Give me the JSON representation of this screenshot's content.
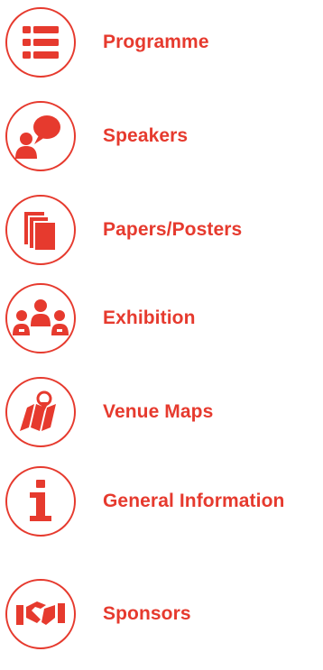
{
  "menu": {
    "accent_color": "#e63a2e",
    "items": [
      {
        "label": "Programme",
        "icon": "list-icon"
      },
      {
        "label": "Speakers",
        "icon": "speech-bubble-person-icon"
      },
      {
        "label": "Papers/Posters",
        "icon": "documents-stack-icon"
      },
      {
        "label": "Exhibition",
        "icon": "people-group-icon"
      },
      {
        "label": "Venue Maps",
        "icon": "map-pin-icon"
      },
      {
        "label": "General Information",
        "icon": "info-icon"
      },
      {
        "label": "Sponsors",
        "icon": "handshake-icon"
      }
    ]
  }
}
